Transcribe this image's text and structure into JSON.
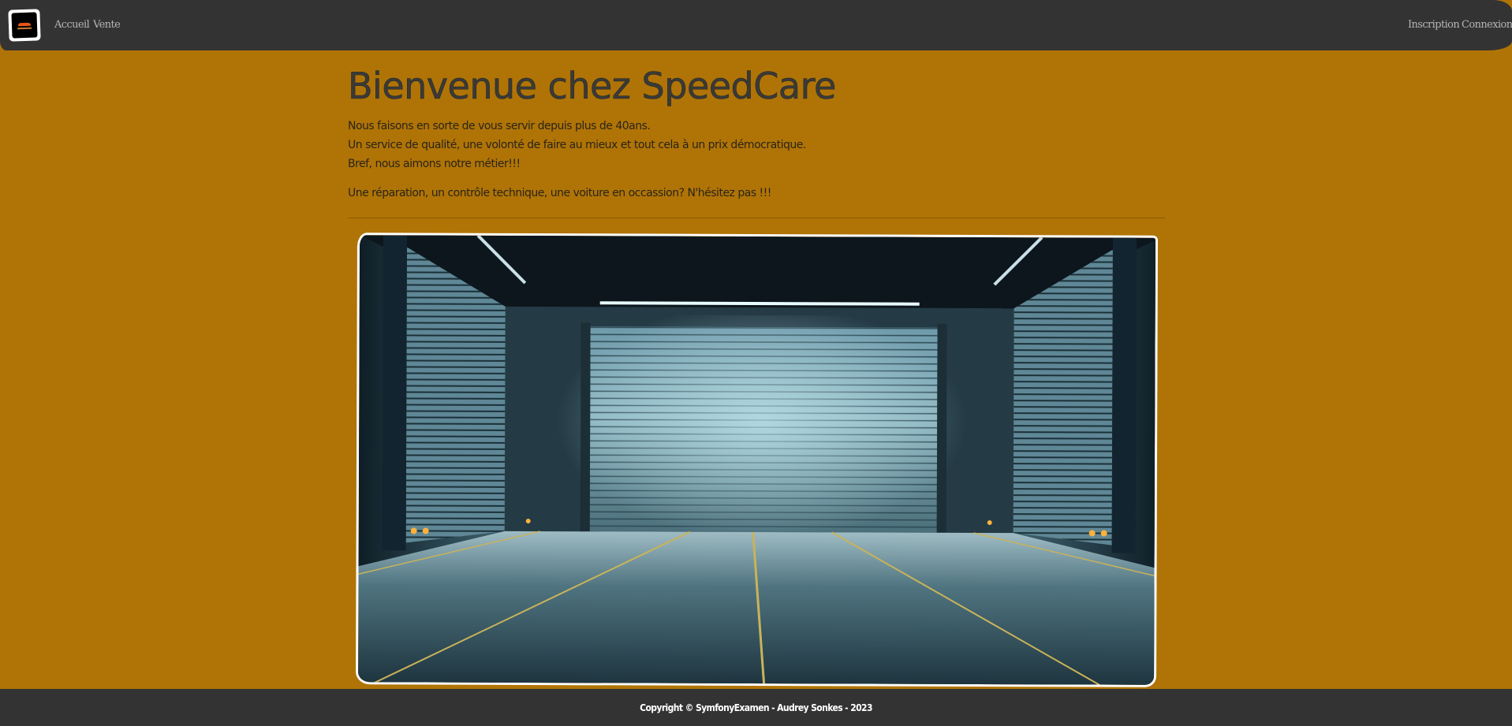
{
  "nav": {
    "links_left": [
      "Accueil",
      "Vente"
    ],
    "links_right": [
      "Inscription",
      "Connexion"
    ]
  },
  "main": {
    "title": "Bienvenue chez SpeedCare",
    "intro_lines": [
      "Nous faisons en sorte de vous servir depuis plus de 40ans.",
      "Un service de qualité, une volonté de faire au mieux et tout cela à un prix démocratique.",
      "Bref, nous aimons notre métier!!!"
    ],
    "cta": "Une réparation, un contrôle technique, une voiture en occassion? N'hésitez pas !!!"
  },
  "footer": {
    "copyright": "Copyright © SymfonyExamen - Audrey Sonkes - 2023"
  },
  "colors": {
    "background": "#b07406",
    "navbar": "#333333",
    "footer": "#333333"
  },
  "icons": {
    "brand": "speedcare-logo",
    "hero": "garage-image"
  }
}
